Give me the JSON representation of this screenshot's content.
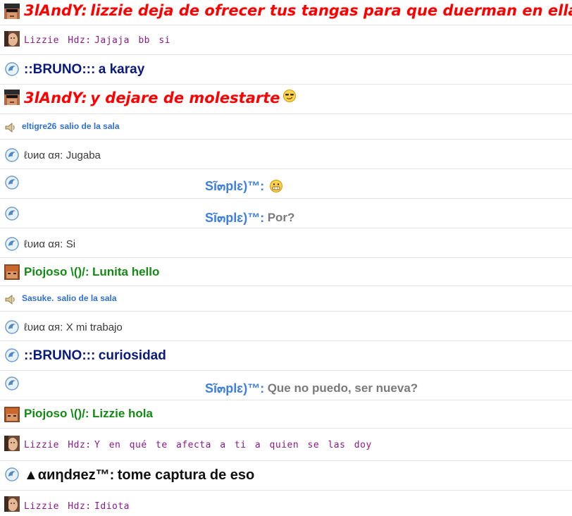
{
  "messages": [
    {
      "id": "m1",
      "sender": "3lAndY:",
      "text": "lizzie deja de ofrecer tus tangas para que duerman en ellas",
      "avatar": "avatar-andy"
    },
    {
      "id": "m2",
      "sender": "Lizzie Hdz:",
      "text": "Jajaja bb si",
      "avatar": "avatar-lizzie"
    },
    {
      "id": "m3",
      "sender": "::BRUNO:::",
      "text": "a karay",
      "avatar": "dolphin-icon"
    },
    {
      "id": "m4",
      "sender": "3lAndY:",
      "text": "y dejare de molestarte",
      "avatar": "avatar-andy",
      "emoji": "smug-emoji"
    },
    {
      "id": "m5",
      "sender": "eltigre26",
      "text": "salio de la sala",
      "avatar": "speaker-icon"
    },
    {
      "id": "m6",
      "sender": "ℓυиα αя:",
      "text": "Jugaba",
      "avatar": "dolphin-icon"
    },
    {
      "id": "m7",
      "sender": "Sĩ๓plɛ)™:",
      "text": "",
      "avatar": "dolphin-icon",
      "emoji": "grin-emoji"
    },
    {
      "id": "m8",
      "sender": "Sĩ๓plɛ)™:",
      "text": "Por?",
      "avatar": "dolphin-icon"
    },
    {
      "id": "m9",
      "sender": "ℓυиα αя:",
      "text": "Si",
      "avatar": "dolphin-icon"
    },
    {
      "id": "m10",
      "sender": "Piojoso \\()/:",
      "text": "Lunita hello",
      "avatar": "avatar-piojoso"
    },
    {
      "id": "m11",
      "sender": "Sasuke.",
      "text": "salio de la sala",
      "avatar": "speaker-icon"
    },
    {
      "id": "m12",
      "sender": "ℓυиα αя:",
      "text": "X mi trabajo",
      "avatar": "dolphin-icon"
    },
    {
      "id": "m13",
      "sender": "::BRUNO:::",
      "text": "curiosidad",
      "avatar": "dolphin-icon"
    },
    {
      "id": "m14",
      "sender": "Sĩ๓plɛ)™:",
      "text": "Que no puedo, ser nueva?",
      "avatar": "dolphin-icon"
    },
    {
      "id": "m15",
      "sender": "Piojoso \\()/:",
      "text": "Lizzie hola",
      "avatar": "avatar-piojoso"
    },
    {
      "id": "m16",
      "sender": "Lizzie Hdz:",
      "text": "Y en qué te afecta a ti a quien se las doy",
      "avatar": "avatar-lizzie"
    },
    {
      "id": "m17",
      "sender": "▲αиηdяez™:",
      "text": "tome captura de eso",
      "avatar": "dolphin-icon"
    },
    {
      "id": "m18",
      "sender": "Lizzie Hdz:",
      "text": "Idiota",
      "avatar": "avatar-lizzie"
    }
  ],
  "colors": {
    "andy": "#ff0000",
    "lizzie": "#8b1a8b",
    "bruno": "#0a1a7a",
    "system": "#2f6fd8",
    "luna": "#3a3a3a",
    "simple": "#3d7fe0",
    "simple_msg": "#7a7a7a",
    "piojoso": "#138a13",
    "andrez": "#111111"
  }
}
